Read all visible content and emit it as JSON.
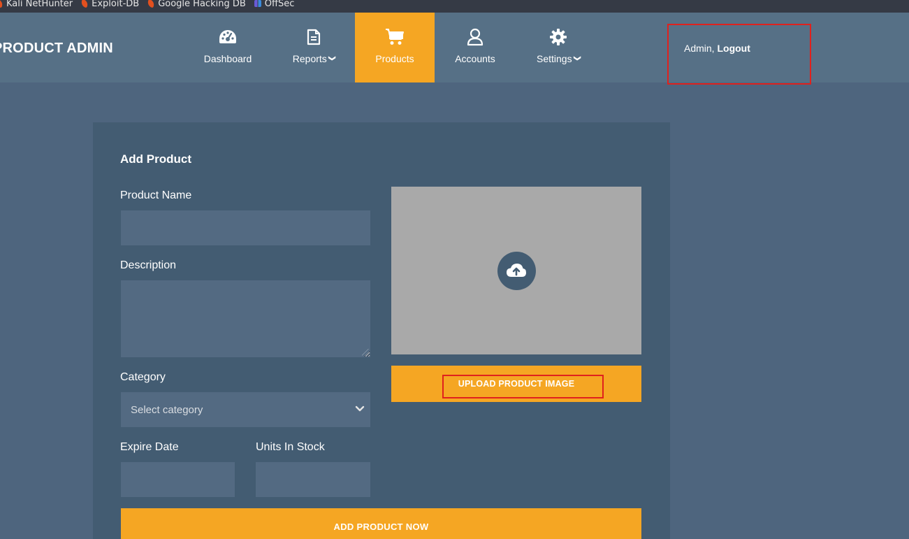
{
  "bookmarks": [
    {
      "label": "Kali NetHunter",
      "icon": "kali-dragon-icon"
    },
    {
      "label": "Exploit-DB",
      "icon": "exploit-db-icon"
    },
    {
      "label": "Google Hacking DB",
      "icon": "ghdb-icon"
    },
    {
      "label": "OffSec",
      "icon": "offsec-icon"
    }
  ],
  "header": {
    "brand": "PRODUCT ADMIN",
    "nav": [
      {
        "label": "Dashboard",
        "icon": "dashboard-gauge-icon",
        "caret": ""
      },
      {
        "label": "Reports",
        "icon": "document-icon",
        "caret": "❯"
      },
      {
        "label": "Products",
        "icon": "shopping-cart-icon",
        "caret": "",
        "active": true
      },
      {
        "label": "Accounts",
        "icon": "user-icon",
        "caret": ""
      },
      {
        "label": "Settings",
        "icon": "gear-icon",
        "caret": "❯"
      }
    ],
    "user": {
      "name": "Admin,",
      "logout": "Logout"
    }
  },
  "form": {
    "title": "Add Product",
    "product_name_label": "Product Name",
    "product_name_value": "",
    "description_label": "Description",
    "description_value": "",
    "category_label": "Category",
    "category_selected": "Select category",
    "expire_date_label": "Expire Date",
    "expire_date_value": "",
    "units_label": "Units In Stock",
    "units_value": "",
    "upload_button": "UPLOAD PRODUCT IMAGE",
    "submit_button": "ADD PRODUCT NOW"
  },
  "colors": {
    "accent": "#f5a623",
    "background": "#4e657e",
    "navbar": "#567086",
    "card": "#435c72",
    "field": "#536a82",
    "highlight": "#e0211d"
  }
}
